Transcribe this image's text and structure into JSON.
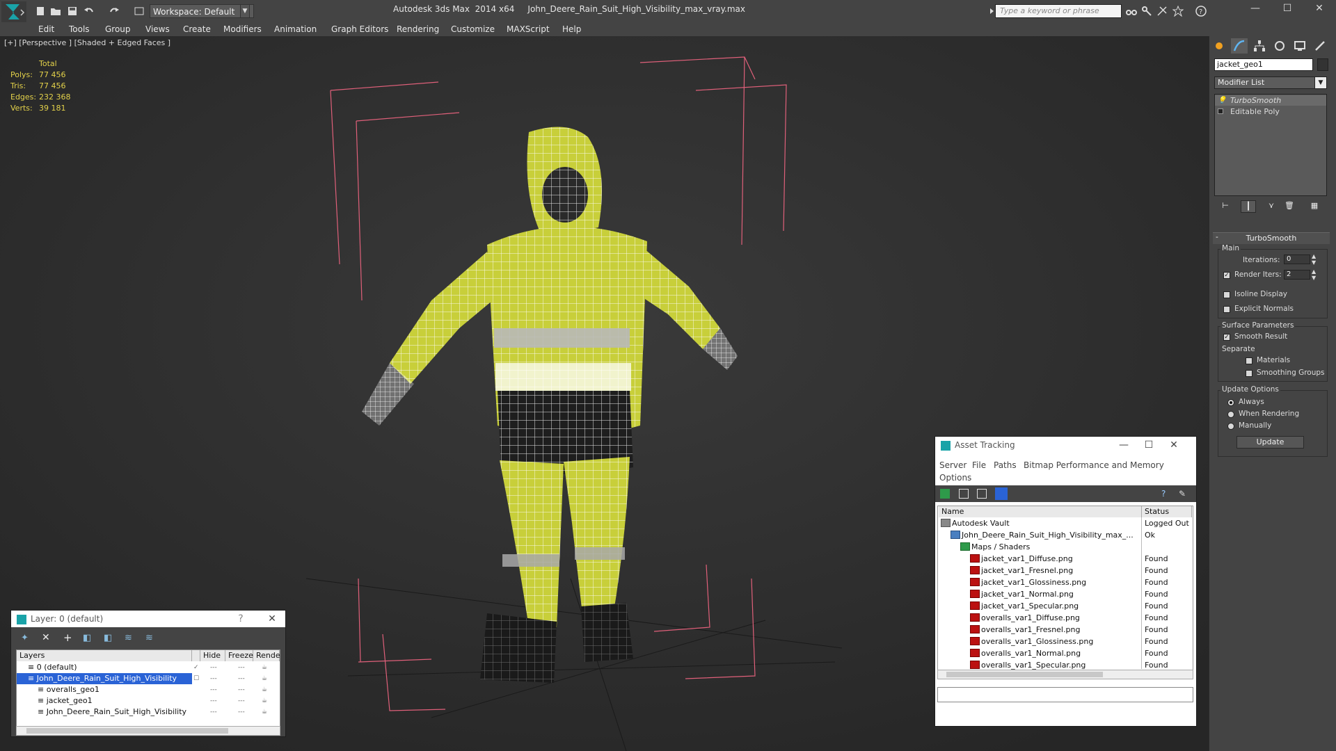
{
  "app": {
    "title": "Autodesk 3ds Max  2014 x64     John_Deere_Rain_Suit_High_Visibility_max_vray.max",
    "workspace": "Workspace: Default",
    "search_placeholder": "Type a keyword or phrase"
  },
  "menu": [
    "Edit",
    "Tools",
    "Group",
    "Views",
    "Create",
    "Modifiers",
    "Animation",
    "Graph Editors",
    "Rendering",
    "Customize",
    "MAXScript",
    "Help"
  ],
  "viewport": {
    "label": "[+] [Perspective ] [Shaded + Edged Faces ]",
    "stats": {
      "header": "Total",
      "rows": [
        {
          "label": "Polys:",
          "value": "77 456"
        },
        {
          "label": "Tris:",
          "value": "77 456"
        },
        {
          "label": "Edges:",
          "value": "232 368"
        },
        {
          "label": "Verts:",
          "value": "39 181"
        }
      ]
    }
  },
  "command_panel": {
    "object_name": "jacket_geo1",
    "modifier_list": "Modifier List",
    "stack": [
      "TurboSmooth",
      "Editable Poly"
    ],
    "rollout": "TurboSmooth",
    "main_label": "Main",
    "iterations_label": "Iterations:",
    "iterations": "0",
    "render_iters_label": "Render Iters:",
    "render_iters": "2",
    "isoline": "Isoline Display",
    "explicit": "Explicit Normals",
    "surface_params": "Surface Parameters",
    "smooth_result": "Smooth Result",
    "separate": "Separate",
    "materials": "Materials",
    "smoothing_groups": "Smoothing Groups",
    "update_options": "Update Options",
    "always": "Always",
    "when_rendering": "When Rendering",
    "manually": "Manually",
    "update_button": "Update"
  },
  "asset_tracking": {
    "title": "Asset Tracking",
    "menu": [
      "Server",
      "File",
      "Paths",
      "Bitmap Performance and Memory",
      "Options"
    ],
    "col_name": "Name",
    "col_status": "Status",
    "rows": [
      {
        "name": "Autodesk Vault",
        "status": "Logged Out",
        "indent": 0,
        "icon": "vault"
      },
      {
        "name": "John_Deere_Rain_Suit_High_Visibility_max_...",
        "status": "Ok",
        "indent": 1,
        "icon": "file"
      },
      {
        "name": "Maps / Shaders",
        "status": "",
        "indent": 2,
        "icon": "folder"
      },
      {
        "name": "jacket_var1_Diffuse.png",
        "status": "Found",
        "indent": 3,
        "icon": "png"
      },
      {
        "name": "jacket_var1_Fresnel.png",
        "status": "Found",
        "indent": 3,
        "icon": "png"
      },
      {
        "name": "jacket_var1_Glossiness.png",
        "status": "Found",
        "indent": 3,
        "icon": "png"
      },
      {
        "name": "jacket_var1_Normal.png",
        "status": "Found",
        "indent": 3,
        "icon": "png"
      },
      {
        "name": "jacket_var1_Specular.png",
        "status": "Found",
        "indent": 3,
        "icon": "png"
      },
      {
        "name": "overalls_var1_Diffuse.png",
        "status": "Found",
        "indent": 3,
        "icon": "png"
      },
      {
        "name": "overalls_var1_Fresnel.png",
        "status": "Found",
        "indent": 3,
        "icon": "png"
      },
      {
        "name": "overalls_var1_Glossiness.png",
        "status": "Found",
        "indent": 3,
        "icon": "png"
      },
      {
        "name": "overalls_var1_Normal.png",
        "status": "Found",
        "indent": 3,
        "icon": "png"
      },
      {
        "name": "overalls_var1_Specular.png",
        "status": "Found",
        "indent": 3,
        "icon": "png"
      }
    ]
  },
  "layer_window": {
    "title": "Layer: 0 (default)",
    "help": "?",
    "col_layers": "Layers",
    "col_hide": "Hide",
    "col_freeze": "Freeze",
    "col_render": "Rende",
    "rows": [
      {
        "name": "0 (default)",
        "indent": 1,
        "selected": false
      },
      {
        "name": "John_Deere_Rain_Suit_High_Visibility",
        "indent": 1,
        "selected": true
      },
      {
        "name": "overalls_geo1",
        "indent": 2,
        "selected": false
      },
      {
        "name": "jacket_geo1",
        "indent": 2,
        "selected": false
      },
      {
        "name": "John_Deere_Rain_Suit_High_Visibility",
        "indent": 2,
        "selected": false
      }
    ]
  },
  "colors": {
    "suit_yellow": "#c8cf3a",
    "bbox_pink": "#e0607a",
    "selection_blue": "#2a63d6",
    "stats_yellow": "#e4d24a"
  }
}
